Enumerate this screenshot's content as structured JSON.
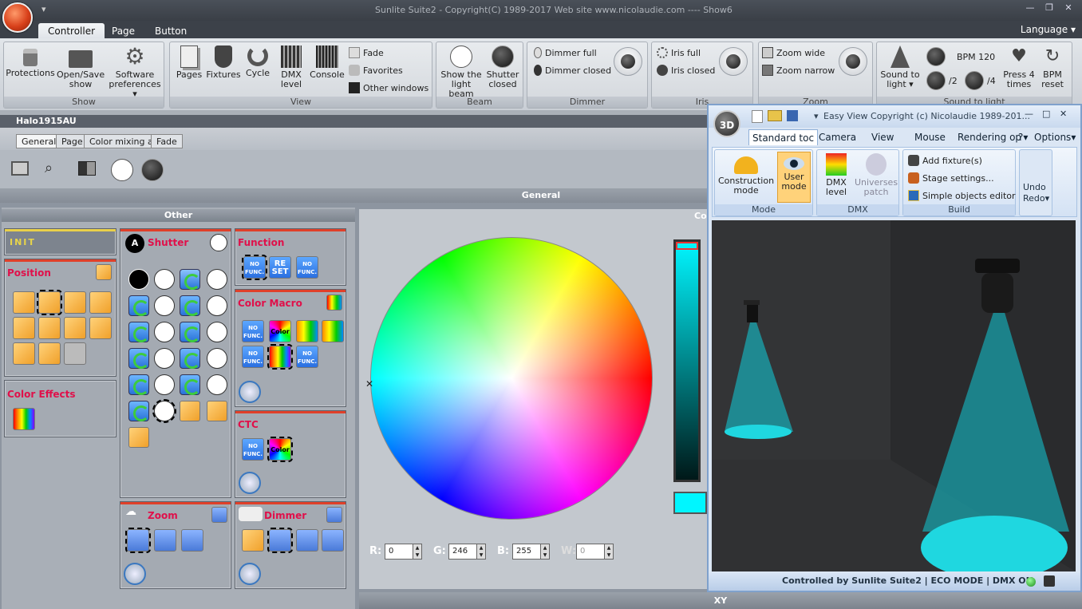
{
  "window": {
    "title": "Sunlite Suite2 - Copyright(C) 1989-2017     Web site www.nicolaudie.com ---- Show6",
    "language": "Language"
  },
  "ribbon_tabs": [
    "Controller",
    "Page",
    "Button"
  ],
  "groups": {
    "show": {
      "label": "Show",
      "protections": "Protections",
      "open_save": "Open/Save show",
      "software_prefs": "Software preferences"
    },
    "view": {
      "label": "View",
      "pages": "Pages",
      "fixtures": "Fixtures",
      "cycle": "Cycle",
      "dmx_level": "DMX level",
      "console": "Console",
      "fade": "Fade",
      "favorites": "Favorites",
      "other_windows": "Other windows"
    },
    "beam": {
      "label": "Beam",
      "show_light_beam": "Show the light beam",
      "shutter_closed": "Shutter closed"
    },
    "dimmer": {
      "label": "Dimmer",
      "full": "Dimmer full",
      "closed": "Dimmer closed"
    },
    "iris": {
      "label": "Iris",
      "full": "Iris full",
      "closed": "Iris closed"
    },
    "zoom": {
      "label": "Zoom",
      "wide": "Zoom wide",
      "narrow": "Zoom narrow"
    },
    "sound": {
      "label": "Sound to light",
      "sound_to_light": "Sound to light",
      "bpm": "BPM 120",
      "div2": "/2",
      "div4": "/4",
      "press4": "Press 4 times",
      "bpm_reset": "BPM reset"
    }
  },
  "document": {
    "title": "Halo1915AU",
    "tabs": [
      "General",
      "Page",
      "Color mixing all",
      "Fade"
    ],
    "general_header": "General",
    "other_header": "Other",
    "xy_header": "XY",
    "color_header": "Co"
  },
  "panels": {
    "init": "INIT",
    "position": "Position",
    "color_effects": "Color Effects",
    "shutter": "Shutter",
    "function": "Function",
    "color_macro": "Color Macro",
    "ctc": "CTC",
    "zoom": "Zoom",
    "dimmer": "Dimmer",
    "no_func": "NO FUNC.",
    "reset": "RE SET",
    "color": "Color"
  },
  "rgb": {
    "r_label": "R:",
    "g_label": "G:",
    "b_label": "B:",
    "w_label": "W:",
    "r": "0",
    "g": "246",
    "b": "255",
    "w": "0",
    "current_color": "#00f6ff"
  },
  "easyview": {
    "title": "Easy View   Copyright (c) Nicolaudie 1989-201...",
    "badge": "3D",
    "tabs": [
      "Standard toc",
      "Camera",
      "View",
      "Mouse",
      "Rendering op"
    ],
    "help": "?",
    "options": "Options",
    "mode": {
      "label": "Mode",
      "construction": "Construction mode",
      "user": "User mode"
    },
    "dmx": {
      "label": "DMX",
      "dmx_level": "DMX level",
      "universes": "Universes patch"
    },
    "build": {
      "label": "Build",
      "add_fixture": "Add fixture(s)",
      "stage_settings": "Stage settings...",
      "simple_objects": "Simple objects editor"
    },
    "undo": "Undo",
    "redo": "Redo",
    "status": "Controlled by Sunlite Suite2   |   ECO MODE   |   DMX ON"
  }
}
